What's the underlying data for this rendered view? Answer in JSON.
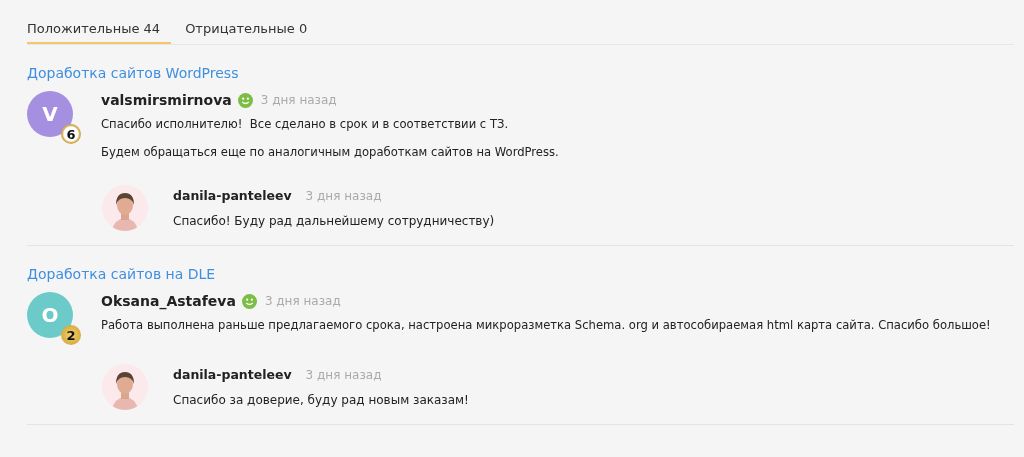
{
  "tabs": [
    {
      "label": "Положительные 44",
      "selected": true
    },
    {
      "label": "Отрицательные 0",
      "selected": false
    }
  ],
  "reviews": [
    {
      "project": "Доработка сайтов WordPress",
      "author": {
        "initial": "V",
        "color": "#a58fe0",
        "badge": {
          "text": "6",
          "kind": "silver"
        }
      },
      "username": "valsmirsmirnova",
      "positive": true,
      "time": "3 дня назад",
      "paragraphs": [
        "Спасибо исполнителю!  Все сделано в срок и в соответствии с ТЗ.",
        "Будем обращаться еще по аналогичным доработкам сайтов на WordPress."
      ],
      "reply": {
        "username": "danila-panteleev",
        "time": "3 дня назад",
        "text": "Спасибо! Буду рад дальнейшему сотрудничеству)"
      }
    },
    {
      "project": "Доработка сайтов на DLE",
      "author": {
        "initial": "O",
        "color": "#6ccbc9",
        "badge": {
          "text": "2",
          "kind": "gold"
        }
      },
      "username": "Oksana_Astafeva",
      "positive": true,
      "time": "3 дня назад",
      "paragraphs": [
        "Работа выполнена раньше предлагаемого срока, настроена микроразметка Schema. org и автособираемая html карта сайта. Спасибо большое!"
      ],
      "reply": {
        "username": "danila-panteleev",
        "time": "3 дня назад",
        "text": "Спасибо за доверие, буду рад новым заказам!"
      }
    }
  ]
}
